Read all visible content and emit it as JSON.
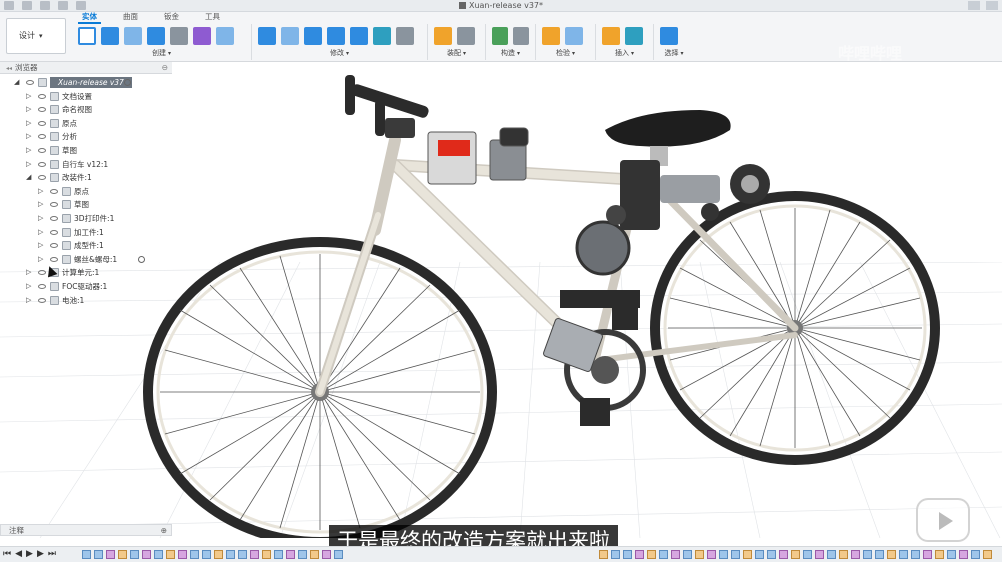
{
  "title_bar": {
    "document_title": "Xuan-release v37*"
  },
  "ribbon": {
    "design_label": "设计",
    "tabs": [
      "实体",
      "曲面",
      "钣金",
      "工具"
    ],
    "active_tab": "实体",
    "groups": [
      {
        "label": "创建"
      },
      {
        "label": "修改"
      },
      {
        "label": "装配"
      },
      {
        "label": "构造"
      },
      {
        "label": "检验"
      },
      {
        "label": "插入"
      },
      {
        "label": "选择"
      }
    ]
  },
  "watermark": "哔哩哔哩",
  "browser": {
    "title": "浏览器",
    "items": [
      {
        "label": "Xuan-release v37",
        "depth": 0,
        "expanded": true,
        "root": true
      },
      {
        "label": "文档设置",
        "depth": 1,
        "expanded": false
      },
      {
        "label": "命名视图",
        "depth": 1,
        "expanded": false
      },
      {
        "label": "原点",
        "depth": 1,
        "expanded": false
      },
      {
        "label": "分析",
        "depth": 1,
        "expanded": false
      },
      {
        "label": "草图",
        "depth": 1,
        "expanded": false
      },
      {
        "label": "自行车 v12:1",
        "depth": 1,
        "expanded": false
      },
      {
        "label": "改装件:1",
        "depth": 1,
        "expanded": true
      },
      {
        "label": "原点",
        "depth": 2,
        "expanded": false
      },
      {
        "label": "草图",
        "depth": 2,
        "expanded": false
      },
      {
        "label": "3D打印件:1",
        "depth": 2,
        "expanded": false
      },
      {
        "label": "加工件:1",
        "depth": 2,
        "expanded": false
      },
      {
        "label": "成型件:1",
        "depth": 2,
        "expanded": false
      },
      {
        "label": "螺丝&螺母:1",
        "depth": 2,
        "expanded": false,
        "radio": true
      },
      {
        "label": "计算单元:1",
        "depth": 1,
        "expanded": false
      },
      {
        "label": "FOC驱动器:1",
        "depth": 1,
        "expanded": false
      },
      {
        "label": "电池:1",
        "depth": 1,
        "expanded": false
      }
    ]
  },
  "comments": {
    "title": "注释"
  },
  "subtitle": "于是最终的改造方案就出来啦",
  "timeline": {
    "controls": [
      "⏮",
      "◀",
      "▶",
      "▶",
      "⏭"
    ]
  },
  "colors": {
    "accent": "#0a7bd6",
    "frame": "#e8e4da",
    "tire": "#2a2a2a",
    "seat": "#1e1e1e",
    "red_light": "#e02a1a"
  }
}
